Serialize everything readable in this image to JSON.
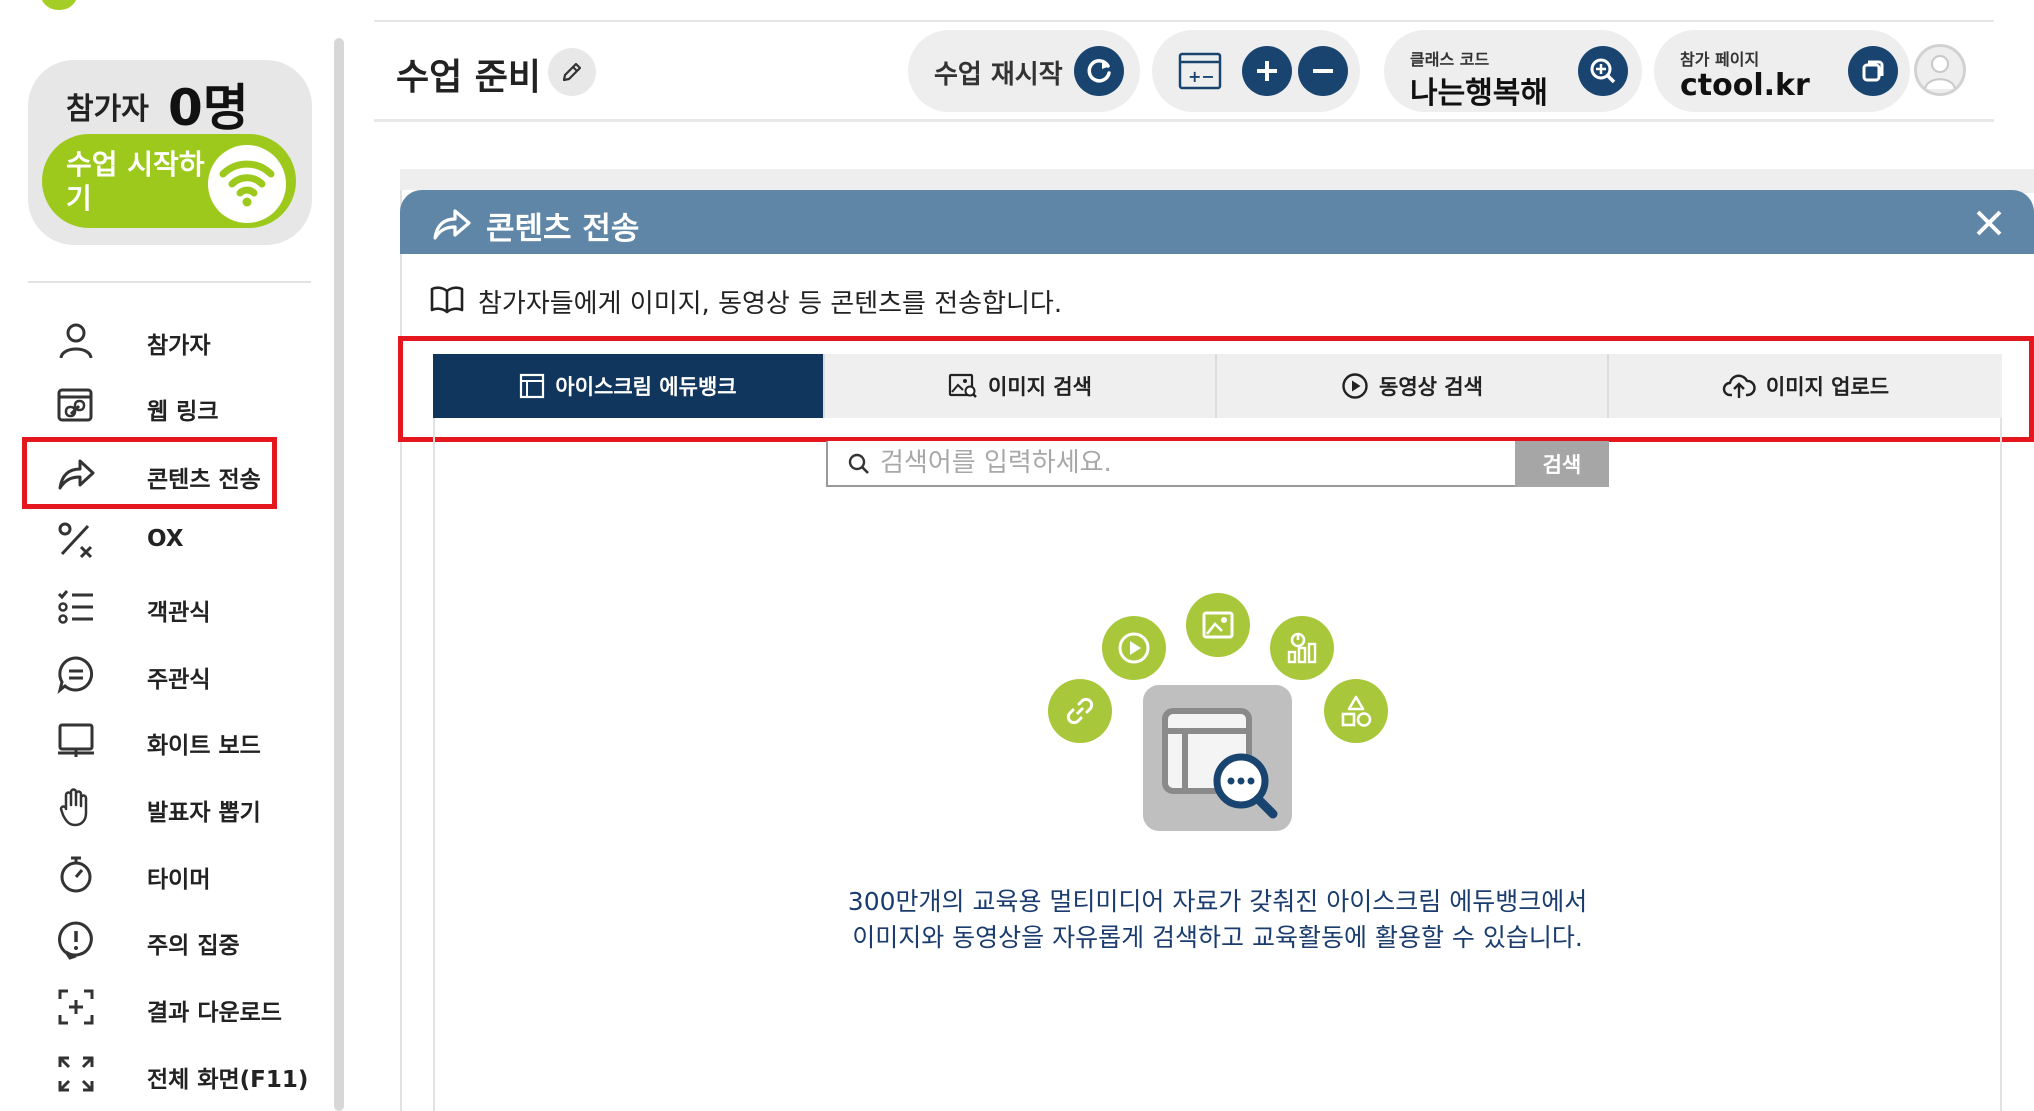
{
  "sidebar": {
    "participants_label": "참가자",
    "participants_count": "0명",
    "start_button_label": "수업 시작하기",
    "items": [
      {
        "label": "참가자",
        "icon": "user-icon"
      },
      {
        "label": "웹 링크",
        "icon": "web-link-icon"
      },
      {
        "label": "콘텐츠 전송",
        "icon": "share-icon"
      },
      {
        "label": "OX",
        "icon": "ox-icon"
      },
      {
        "label": "객관식",
        "icon": "multiple-choice-icon"
      },
      {
        "label": "주관식",
        "icon": "chat-icon"
      },
      {
        "label": "화이트 보드",
        "icon": "whiteboard-icon"
      },
      {
        "label": "발표자 뽑기",
        "icon": "hand-icon"
      },
      {
        "label": "타이머",
        "icon": "timer-icon"
      },
      {
        "label": "주의 집중",
        "icon": "alert-icon"
      },
      {
        "label": "결과 다운로드",
        "icon": "download-icon"
      },
      {
        "label": "전체 화면(F11)",
        "icon": "fullscreen-icon"
      }
    ]
  },
  "header": {
    "title": "수업 준비",
    "restart_label": "수업 재시작",
    "class_code_label": "클래스 코드",
    "class_code_value": "나는행복해",
    "join_page_label": "참가 페이지",
    "join_page_value": "ctool.kr"
  },
  "modal": {
    "title": "콘텐츠 전송",
    "description": "참가자들에게 이미지, 동영상 등 콘텐츠를 전송합니다.",
    "tabs": [
      {
        "label": "아이스크림 에듀뱅크",
        "icon": "layout-icon",
        "active": true
      },
      {
        "label": "이미지 검색",
        "icon": "image-search-icon",
        "active": false
      },
      {
        "label": "동영상 검색",
        "icon": "play-icon",
        "active": false
      },
      {
        "label": "이미지 업로드",
        "icon": "cloud-upload-icon",
        "active": false
      }
    ],
    "search": {
      "placeholder": "검색어를 입력하세요.",
      "button_label": "검색"
    },
    "info_line1": "300만개의 교육용 멀티미디어 자료가 갖춰진 아이스크림 에듀뱅크에서",
    "info_line2": "이미지와 동영상을 자유롭게 검색하고 교육활동에 활용할 수 있습니다."
  },
  "colors": {
    "brand_green": "#9cc91c",
    "navy": "#11365e",
    "modal_header": "#5f86a6",
    "highlight_red": "#e3171d"
  }
}
